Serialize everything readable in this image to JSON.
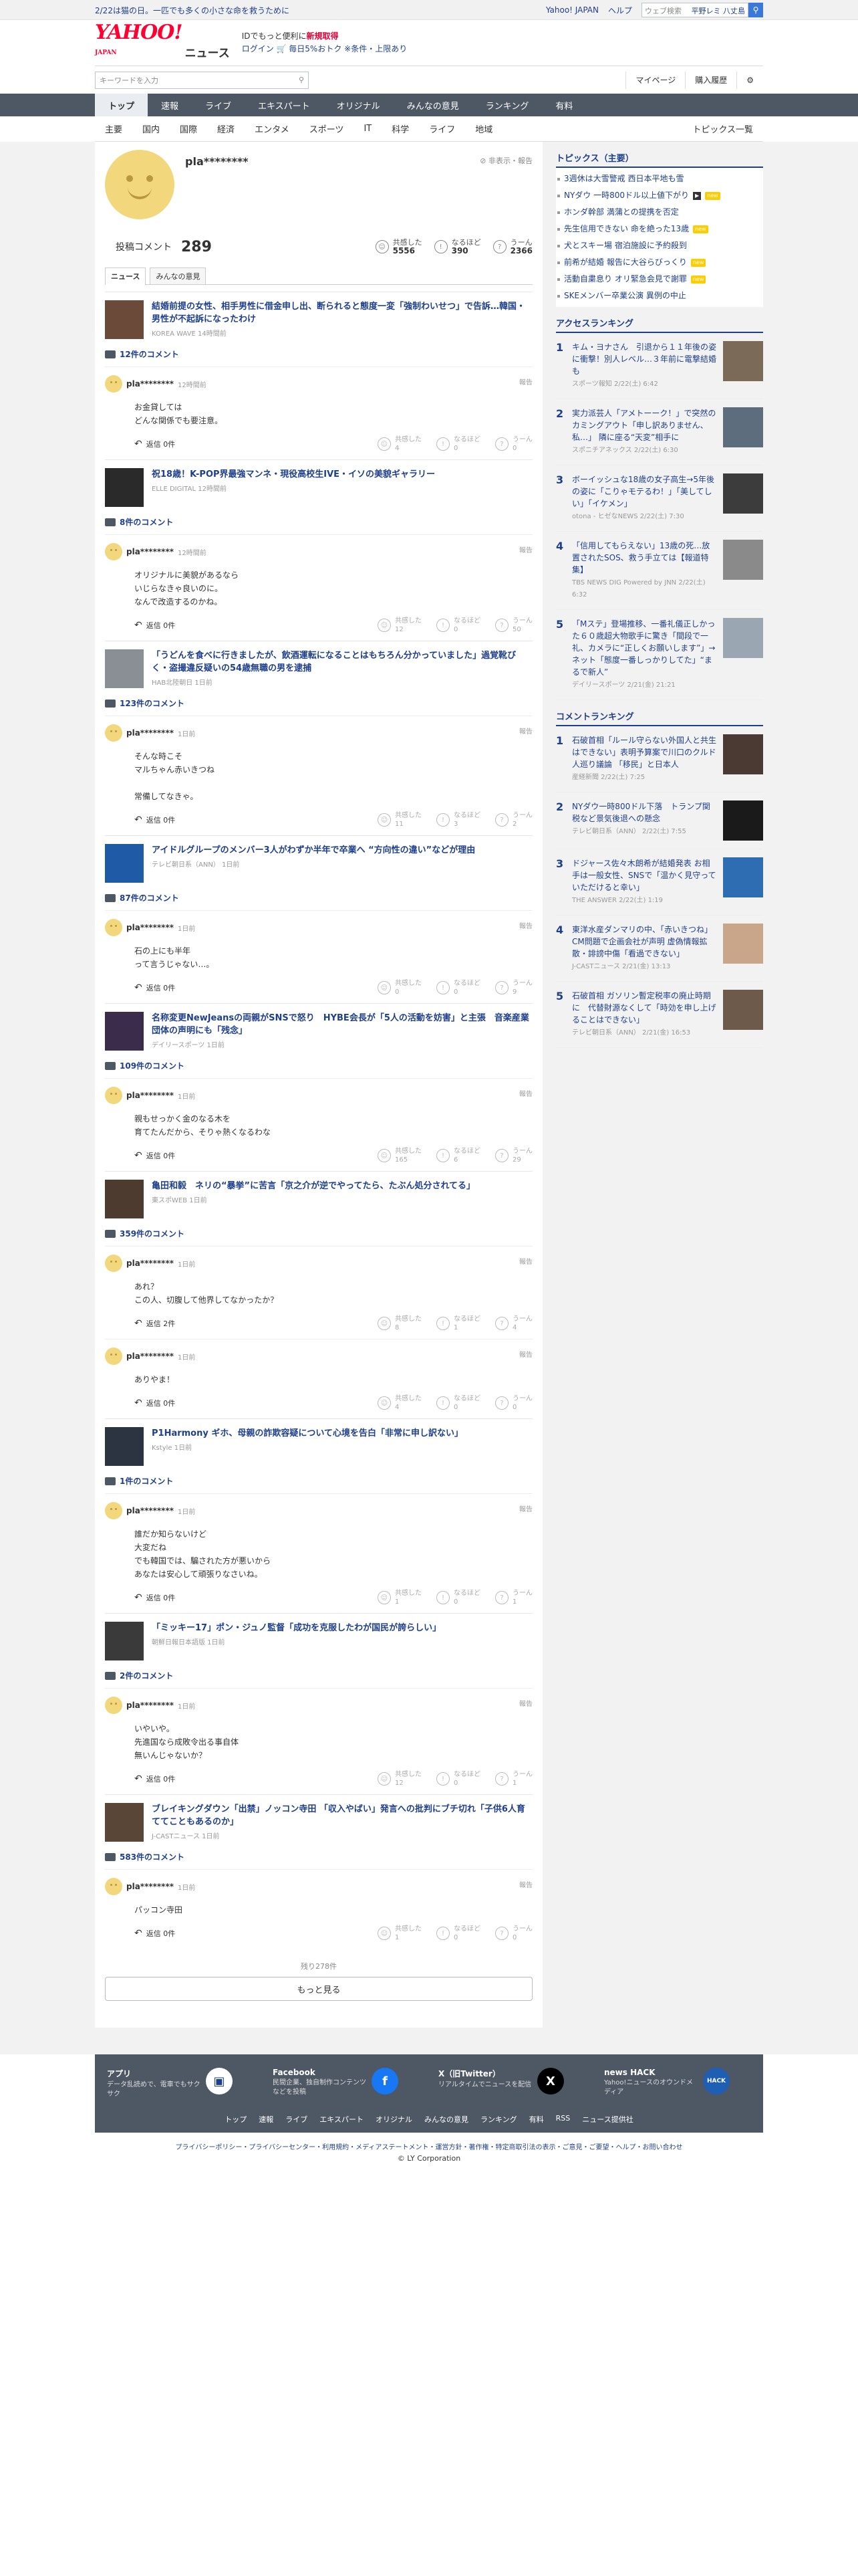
{
  "topband": {
    "promo": "2/22は猫の日。一匹でも多くの小さな命を救うために",
    "links": [
      "Yahoo! JAPAN",
      "ヘルプ"
    ],
    "search_placeholder": "ウェブ検索",
    "search_suggest": "平野レミ 八丈島"
  },
  "header": {
    "logo": "YAHOO!",
    "logo_sub": "JAPAN",
    "logo_news": "ニュース",
    "promo_line1a": "IDでもっと便利に",
    "promo_line1b": "新規取得",
    "promo_line2": "ログイン 🛒 毎日5%おトク ※条件・上限あり"
  },
  "searchbar": {
    "placeholder": "キーワードを入力",
    "mypage": "マイページ",
    "history": "購入履歴"
  },
  "gnav": [
    "トップ",
    "速報",
    "ライブ",
    "エキスパート",
    "オリジナル",
    "みんなの意見",
    "ランキング",
    "有料"
  ],
  "snav": [
    "主要",
    "国内",
    "国際",
    "経済",
    "エンタメ",
    "スポーツ",
    "IT",
    "科学",
    "ライフ",
    "地域"
  ],
  "snav_all": "トピックス一覧",
  "profile": {
    "name": "pla********",
    "hidden": "非表示・報告",
    "comments_label": "投稿コメント",
    "comments": "289",
    "empathy_label": "共感した",
    "empathy": "5556",
    "naruhodo_label": "なるほど",
    "naruhodo": "390",
    "uun_label": "うーん",
    "uun": "2366",
    "tabs": [
      "ニュース",
      "みんなの意見"
    ]
  },
  "articles": [
    {
      "title": "結婚前提の女性、相手男性に借金申し出、断られると態度一変「強制わいせつ」で告訴…韓国・男性が不起訴になったわけ",
      "source": "KOREA WAVE 14時間前",
      "count": "12件のコメント",
      "comments": [
        {
          "user": "pla********",
          "time": "12時間前",
          "body": "お金貸しては\nどんな関係でも要注意。",
          "reply": "返信 0件",
          "r1": "共感した",
          "v1": "4",
          "r2": "なるほど",
          "v2": "0",
          "r3": "うーん",
          "v3": "0"
        }
      ]
    },
    {
      "title": "祝18歳！K-POP界最強マンネ・現役高校生IVE・イソの美貌ギャラリー",
      "source": "ELLE DIGITAL 12時間前",
      "count": "8件のコメント",
      "comments": [
        {
          "user": "pla********",
          "time": "12時間前",
          "body": "オリジナルに美貌があるなら\nいじらなきゃ良いのに。\nなんで改造するのかね。",
          "reply": "返信 0件",
          "r1": "共感した",
          "v1": "12",
          "r2": "なるほど",
          "v2": "0",
          "r3": "うーん",
          "v3": "50"
        }
      ]
    },
    {
      "title": "「うどんを食べに行きましたが、飲酒運転になることはもちろん分かっていました」過覚靴びく・盗撮違反疑いの54歳無職の男を逮捕",
      "source": "HAB北陸朝日 1日前",
      "count": "123件のコメント",
      "comments": [
        {
          "user": "pla********",
          "time": "1日前",
          "body": "そんな時こそ\nマルちゃん赤いきつね\n\n常備してなきゃ。",
          "reply": "返信 0件",
          "r1": "共感した",
          "v1": "11",
          "r2": "なるほど",
          "v2": "3",
          "r3": "うーん",
          "v3": "2"
        }
      ]
    },
    {
      "title": "アイドルグループのメンバー3人がわずか半年で卒業へ “方向性の違い”などが理由",
      "source": "テレビ朝日系（ANN） 1日前",
      "count": "87件のコメント",
      "comments": [
        {
          "user": "pla********",
          "time": "1日前",
          "body": "石の上にも半年\nって言うじゃない…。",
          "reply": "返信 0件",
          "r1": "共感した",
          "v1": "0",
          "r2": "なるほど",
          "v2": "0",
          "r3": "うーん",
          "v3": "9"
        }
      ]
    },
    {
      "title": "名称変更NewJeansの両親がSNSで怒り　HYBE会長が「5人の活動を妨害」と主張　音楽産業団体の声明にも「残念」",
      "source": "デイリースポーツ 1日前",
      "count": "109件のコメント",
      "comments": [
        {
          "user": "pla********",
          "time": "1日前",
          "body": "親もせっかく金のなる木を\n育てたんだから、そりゃ熱くなるわな",
          "reply": "返信 0件",
          "r1": "共感した",
          "v1": "165",
          "r2": "なるほど",
          "v2": "6",
          "r3": "うーん",
          "v3": "29"
        }
      ]
    },
    {
      "title": "亀田和毅　ネリの“暴挙”に苦言「京之介が逆でやってたら、たぶん処分されてる」",
      "source": "東スポWEB 1日前",
      "count": "359件のコメント",
      "comments": [
        {
          "user": "pla********",
          "time": "1日前",
          "body": "あれ？\nこの人、切腹して他界してなかったか？",
          "reply": "返信 2件",
          "r1": "共感した",
          "v1": "8",
          "r2": "なるほど",
          "v2": "1",
          "r3": "うーん",
          "v3": "4"
        },
        {
          "user": "pla********",
          "time": "1日前",
          "body": "ありやま！",
          "reply": "返信 0件",
          "r1": "共感した",
          "v1": "4",
          "r2": "なるほど",
          "v2": "0",
          "r3": "うーん",
          "v3": "0"
        }
      ]
    },
    {
      "title": "P1Harmony ギホ、母親の詐欺容疑について心境を告白「非常に申し訳ない」",
      "source": "Kstyle 1日前",
      "count": "1件のコメント",
      "comments": [
        {
          "user": "pla********",
          "time": "1日前",
          "body": "誰だか知らないけど\n大変だね\nでも韓国では、騙された方が悪いから\nあなたは安心して頑張りなさいね。",
          "reply": "返信 0件",
          "r1": "共感した",
          "v1": "1",
          "r2": "なるほど",
          "v2": "0",
          "r3": "うーん",
          "v3": "1"
        }
      ]
    },
    {
      "title": "「ミッキー17」ポン・ジュノ監督「成功を克服したわが国民が誇らしい」",
      "source": "朝鮮日報日本語版 1日前",
      "count": "2件のコメント",
      "comments": [
        {
          "user": "pla********",
          "time": "1日前",
          "body": "いやいや。\n先進国なら成敗令出る事自体\n無いんじゃないか？",
          "reply": "返信 0件",
          "r1": "共感した",
          "v1": "12",
          "r2": "なるほど",
          "v2": "0",
          "r3": "うーん",
          "v3": "1"
        }
      ]
    },
    {
      "title": "ブレイキングダウン「出禁」ノッコン寺田 「収入やばい」発言への批判にブチ切れ「子供6人育ててこともあるのか」",
      "source": "J-CASTニュース 1日前",
      "count": "583件のコメント",
      "comments": [
        {
          "user": "pla********",
          "time": "1日前",
          "body": "パッコン寺田",
          "reply": "返信 0件",
          "r1": "共感した",
          "v1": "1",
          "r2": "なるほど",
          "v2": "0",
          "r3": "うーん",
          "v3": "0"
        }
      ]
    }
  ],
  "remaining": "残り278件",
  "more": "もっと見る",
  "side": {
    "topics_title": "トピックス（主要）",
    "topics": [
      {
        "t": "3週休は大雪警戒 西日本平地も雪",
        "b": ""
      },
      {
        "t": "NYダウ 一時800ドル以上値下がり",
        "b": "new",
        "v": true
      },
      {
        "t": "ホンダ幹部 満蒲との提携を否定",
        "b": ""
      },
      {
        "t": "先生信用できない 命を絶った13歳",
        "b": "new"
      },
      {
        "t": "犬とスキー場 宿泊施設に予約殺到",
        "b": ""
      },
      {
        "t": "前希が結婚 報告に大谷らびっくり",
        "b": "new"
      },
      {
        "t": "活動自粛息り オリ緊急会見で謝罪",
        "b": "new"
      },
      {
        "t": "SKEメンバー卒業公演 異例の中止",
        "b": ""
      }
    ],
    "access_title": "アクセスランキング",
    "access": [
      {
        "n": "1",
        "t": "キム・ヨナさん　引退から１１年後の姿に衝撃！別人レベル…３年前に電撃結婚も",
        "s": "スポーツ報知 2/22(土) 6:42"
      },
      {
        "n": "2",
        "t": "実力派芸人「アメトーーク！」で突然のカミングアウト「申し訳ありません、私…」 隣に座る“天変”相手に",
        "s": "スポニチアネックス 2/22(土) 6:30"
      },
      {
        "n": "3",
        "t": "ボーイッシュな18歳の女子高生→5年後の姿に「こりゃモテるわ！」「美してしい」「イケメン」",
        "s": "otona - ヒゼなNEWS 2/22(土) 7:30"
      },
      {
        "n": "4",
        "t": "「信用してもらえない」13歳の死…放置されたSOS、救う手立ては【報道特集】",
        "s": "TBS NEWS DIG Powered by JNN 2/22(土) 6:32"
      },
      {
        "n": "5",
        "t": "「Mステ」登場推移、一番礼儀正しかった６０歳超大物歌手に驚き「間段で一礼、カメラに“正しくお願いします”」→ネット「態度一番しっかりしてた」“まるで新人”",
        "s": "デイリースポーツ 2/21(金) 21:21"
      }
    ],
    "comment_title": "コメントランキング",
    "crank": [
      {
        "n": "1",
        "t": "石破首相「ルール守らない外国人と共生はできない」表明予算案で川口のクルド人巡り議論 「移民」と日本人",
        "s": "産経新聞 2/22(土) 7:25"
      },
      {
        "n": "2",
        "t": "NYダウ一時800ドル下落　トランプ関税など景気後退への懸念",
        "s": "テレビ朝日系（ANN） 2/22(土) 7:55"
      },
      {
        "n": "3",
        "t": "ドジャース佐々木朗希が結婚発表 お相手は一般女性、SNSで「温かく見守っていただけると幸い」",
        "s": "THE ANSWER 2/22(土) 1:19"
      },
      {
        "n": "4",
        "t": "東洋水産ダンマリの中、「赤いきつね」CM問題で企画会社が声明 虚偽情報拡散・誹謗中傷「看過できない」",
        "s": "J-CASTニュース 2/21(金) 13:13"
      },
      {
        "n": "5",
        "t": "石破首相 ガソリン暫定税率の廃止時期に　代替財源なくして「時効を申し上げることはできない」",
        "s": "テレビ朝日系（ANN） 2/21(金) 16:53"
      }
    ]
  },
  "footer": {
    "apps": [
      {
        "t": "アプリ",
        "d": "データ乱読めで、電車でもサクサク",
        "i": "▣"
      },
      {
        "t": "Facebook",
        "d": "民間企業、独自制作コンテンツなどを投稿",
        "i": "f"
      },
      {
        "t": "X（旧Twitter）",
        "d": "リアルタイムでニュースを配信",
        "i": "X"
      },
      {
        "t": "news HACK",
        "d": "Yahoo!ニュースのオウンドメディア",
        "i": "HACK"
      }
    ],
    "links": [
      "トップ",
      "速報",
      "ライブ",
      "エキスパート",
      "オリジナル",
      "みんなの意見",
      "ランキング",
      "有料",
      "RSS",
      "ニュース提供社"
    ],
    "legal": "プライバシーポリシー・プライバシーセンター・利用規約・メディアステートメント・運営方針・著作権・特定商取引法の表示・ご意見・ご要望・ヘルプ・お問い合わせ",
    "copy": "© LY Corporation"
  }
}
